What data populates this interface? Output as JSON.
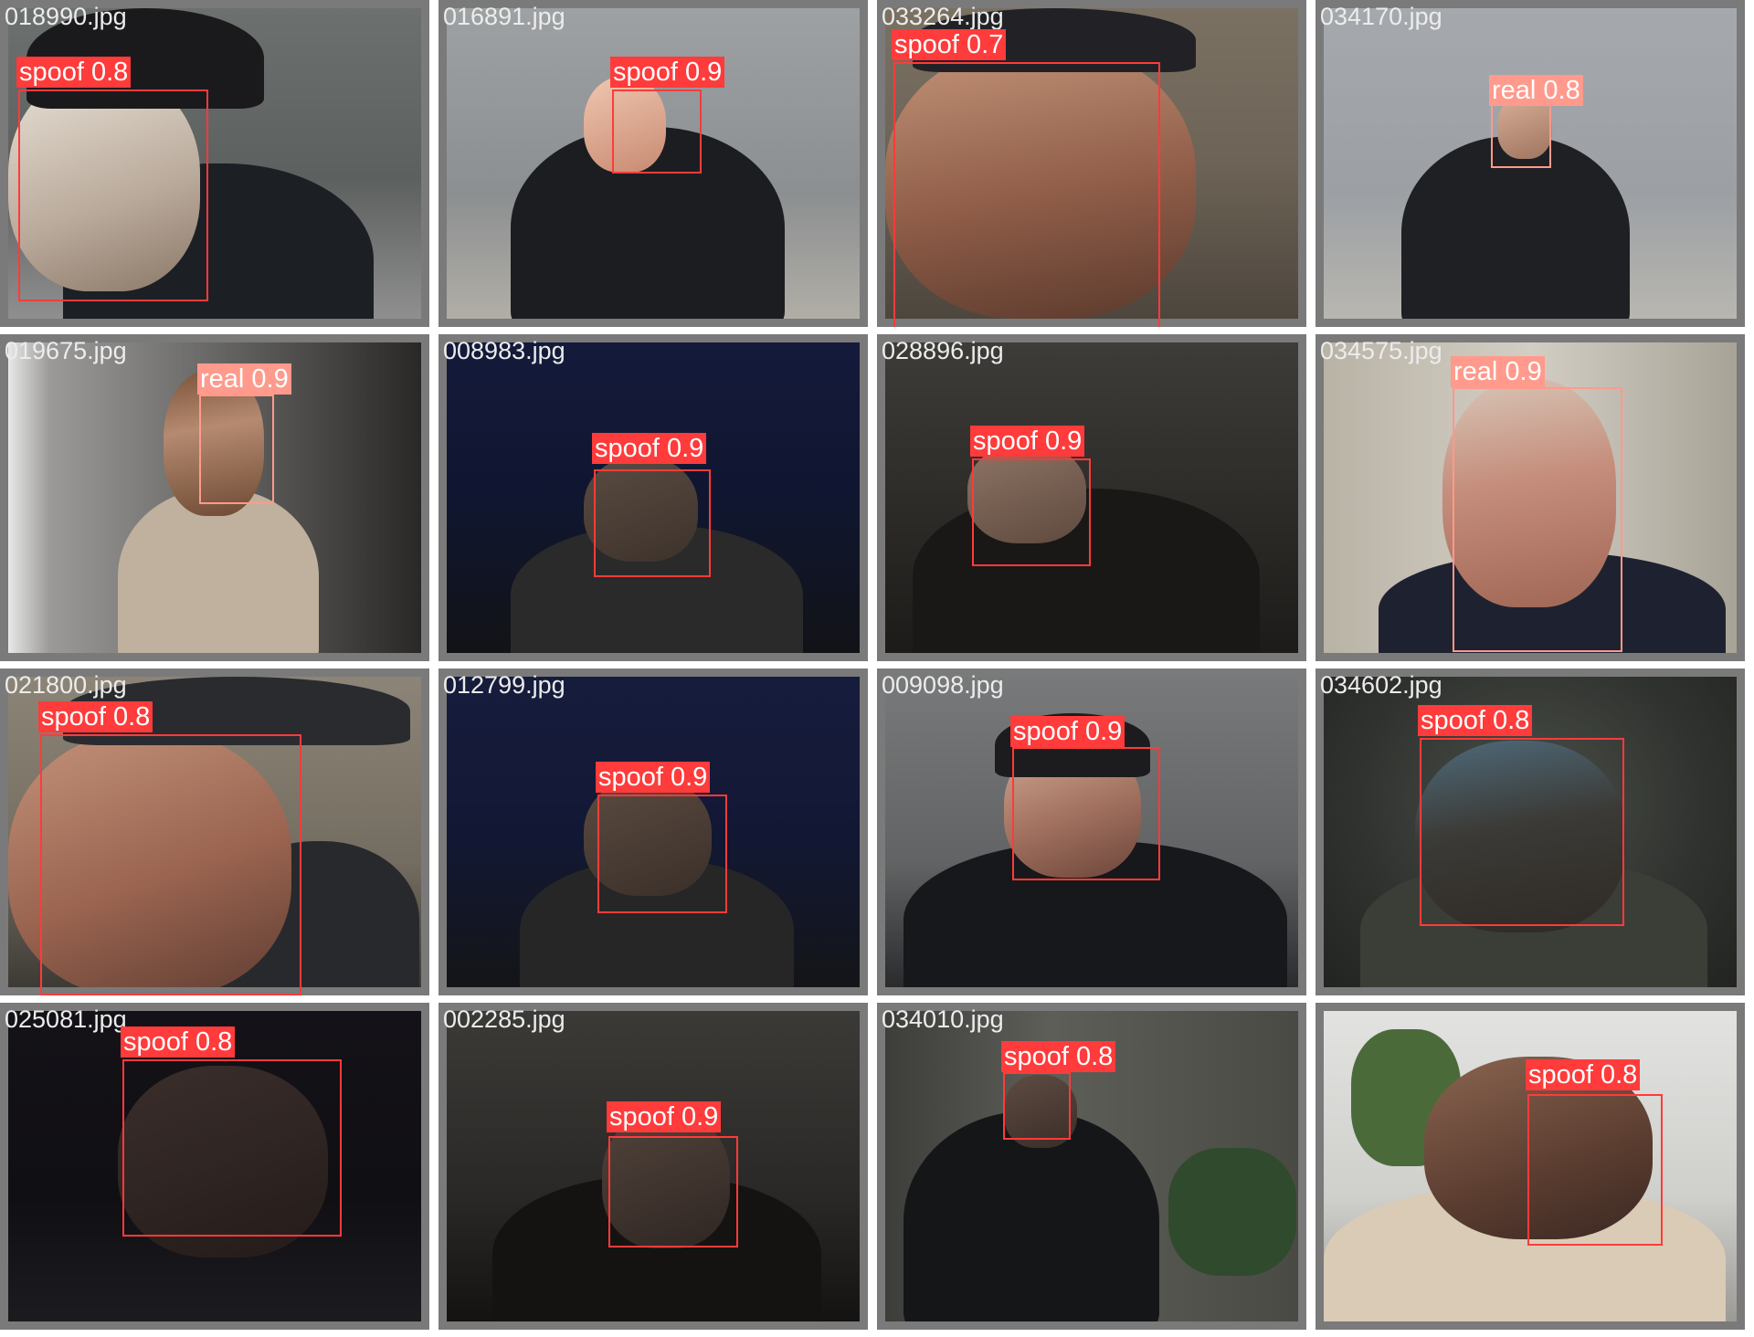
{
  "colors": {
    "spoof": "#ff3b3b",
    "real": "#ff9a8c",
    "tile_border": "#7a7a7a"
  },
  "tiles": [
    {
      "file": "018990.jpg",
      "label": "spoof 0.8",
      "cls": "spoof",
      "scene": "outdoor-wall"
    },
    {
      "file": "016891.jpg",
      "label": "spoof 0.9",
      "cls": "spoof",
      "scene": "gray-lockers"
    },
    {
      "file": "033264.jpg",
      "label": "spoof 0.7",
      "cls": "spoof",
      "scene": "closeup-mask"
    },
    {
      "file": "034170.jpg",
      "label": "real 0.8",
      "cls": "real",
      "scene": "gray-lockers"
    },
    {
      "file": "019675.jpg",
      "label": "real 0.9",
      "cls": "real",
      "scene": "woman-portrait"
    },
    {
      "file": "008983.jpg",
      "label": "spoof 0.9",
      "cls": "spoof",
      "scene": "dark-blue"
    },
    {
      "file": "028896.jpg",
      "label": "spoof 0.9",
      "cls": "spoof",
      "scene": "dark-room"
    },
    {
      "file": "034575.jpg",
      "label": "real 0.9",
      "cls": "real",
      "scene": "man-portrait"
    },
    {
      "file": "021800.jpg",
      "label": "spoof 0.8",
      "cls": "spoof",
      "scene": "closeup-cap"
    },
    {
      "file": "012799.jpg",
      "label": "spoof 0.9",
      "cls": "spoof",
      "scene": "dark-blue"
    },
    {
      "file": "009098.jpg",
      "label": "spoof 0.9",
      "cls": "spoof",
      "scene": "gray-room"
    },
    {
      "file": "034602.jpg",
      "label": "spoof 0.8",
      "cls": "spoof",
      "scene": "dark-green"
    },
    {
      "file": "025081.jpg",
      "label": "spoof 0.8",
      "cls": "spoof",
      "scene": "very-dark"
    },
    {
      "file": "002285.jpg",
      "label": "spoof 0.9",
      "cls": "spoof",
      "scene": "dark-room"
    },
    {
      "file": "034010.jpg",
      "label": "spoof 0.8",
      "cls": "spoof",
      "scene": "office"
    },
    {
      "file": "",
      "label": "spoof 0.8",
      "cls": "spoof",
      "scene": "bright-room"
    }
  ]
}
